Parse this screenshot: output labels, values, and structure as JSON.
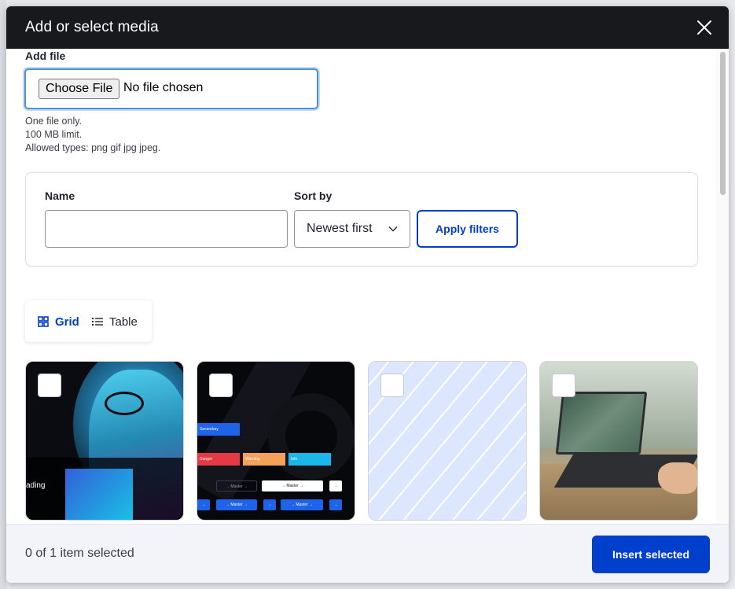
{
  "dialog": {
    "title": "Add or select media",
    "close_icon": "close-icon"
  },
  "add_file": {
    "label": "Add file",
    "choose_button": "Choose File",
    "status": "No file chosen",
    "help": [
      "One file only.",
      "100 MB limit.",
      "Allowed types: png gif jpg jpeg."
    ]
  },
  "filters": {
    "name_label": "Name",
    "name_value": "",
    "sort_label": "Sort by",
    "sort_value": "Newest first",
    "apply_label": "Apply filters"
  },
  "view_switch": {
    "grid_label": "Grid",
    "grid_icon": "grid-icon",
    "table_label": "Table",
    "table_icon": "list-icon",
    "active": "grid"
  },
  "media_items": [
    {
      "thumb": "portrait-man-glasses",
      "caption_fragment": "ading",
      "checked": false
    },
    {
      "thumb": "ui-buttons-dark",
      "chips": [
        "Secondary",
        "Danger",
        "Warning",
        "Info"
      ],
      "buttons": [
        "→ Master →",
        "→ Master →",
        "→ Master →",
        "→ Master →"
      ],
      "checked": false
    },
    {
      "thumb": "placeholder-stripes",
      "checked": false
    },
    {
      "thumb": "laptop-on-desk",
      "checked": false
    }
  ],
  "footer": {
    "selection_count": "0 of 1 item selected",
    "insert_label": "Insert selected"
  },
  "colors": {
    "accent": "#003ecc",
    "titlebar": "#18191d",
    "focus_ring": "#4f8fe0"
  }
}
